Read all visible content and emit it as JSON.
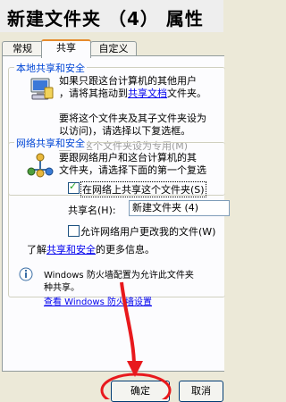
{
  "window": {
    "title": "新建文件夹 （4） 属性"
  },
  "tabs": [
    {
      "label": "常规"
    },
    {
      "label": "共享"
    },
    {
      "label": "自定义"
    }
  ],
  "local_share": {
    "title": "本地共享和安全",
    "text1_line1": "如果只跟这台计算机的其他用户",
    "text1_line2_prefix": "，请将其拖动到",
    "text1_link": "共享文档",
    "text1_line2_suffix": "文件夹。",
    "text2_line1": "要将这个文件夹及其子文件夹设为",
    "text2_line2": "以访问)，请选择以下复选框。",
    "checkbox_label": "将这个文件夹设为专用(M)"
  },
  "network_share": {
    "title": "网络共享和安全",
    "text_line1": "要跟网络用户和这台计算机的其",
    "text_line2": "文件夹，请选择下面的第一个复选",
    "share_checkbox_label": "在网络上共享这个文件夹(S)",
    "share_name_label": "共享名(H):",
    "share_name_value": "新建文件夹 (4)",
    "allow_checkbox_label": "允许网络用户更改我的文件(W)",
    "learn_prefix": "了解",
    "learn_link": "共享和安全",
    "learn_suffix": "的更多信息。"
  },
  "firewall": {
    "text_line1": "Windows 防火墙配置为允许此文件夹",
    "text_line2": "种共享。",
    "link": "查看 Windows 防火墙设置"
  },
  "buttons": {
    "ok": "确定",
    "cancel": "取消"
  },
  "colors": {
    "annotation": "#e8191d",
    "link": "#0000ee",
    "group_title": "#0046d5"
  }
}
